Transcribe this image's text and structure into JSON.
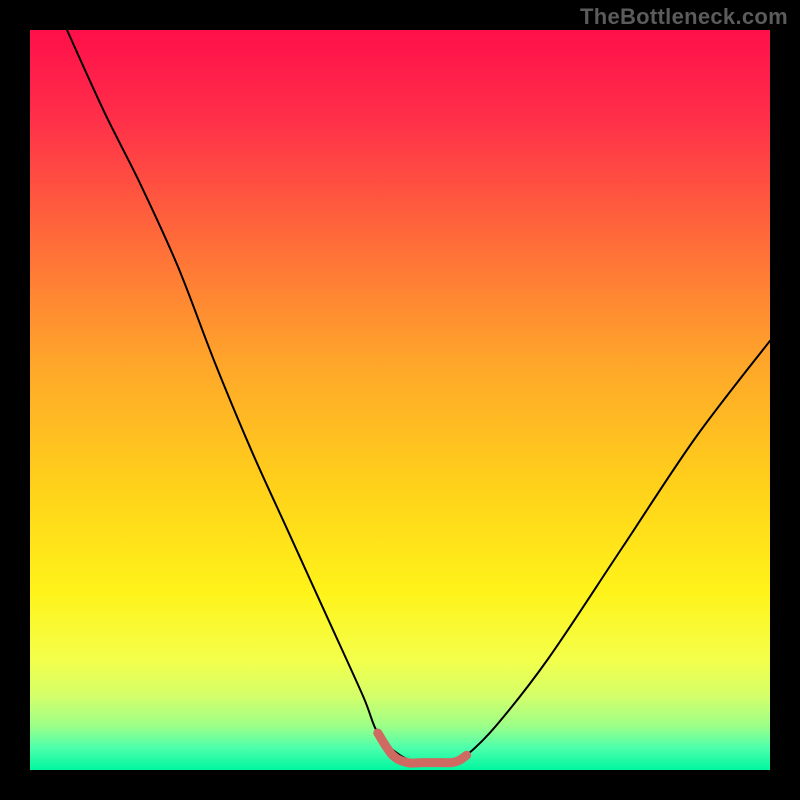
{
  "watermark": "TheBottleneck.com",
  "chart_data": {
    "type": "line",
    "title": "",
    "xlabel": "",
    "ylabel": "",
    "xlim": [
      0,
      100
    ],
    "ylim": [
      0,
      100
    ],
    "grid": false,
    "legend": false,
    "series": [
      {
        "name": "bottleneck-curve",
        "color": "#000000",
        "width": 2,
        "x": [
          5,
          10,
          15,
          20,
          25,
          30,
          35,
          40,
          45,
          47,
          50,
          53,
          57,
          59,
          63,
          70,
          80,
          90,
          100
        ],
        "y": [
          100,
          89,
          79,
          68,
          55,
          43,
          32,
          21,
          10,
          5,
          2,
          1,
          1,
          2,
          6,
          15,
          30,
          45,
          58
        ]
      },
      {
        "name": "bottleneck-zone-band",
        "color": "#cf6a62",
        "width": 9,
        "x": [
          47,
          49,
          51,
          53,
          55,
          57,
          58,
          59
        ],
        "y": [
          5,
          2,
          1,
          1,
          1,
          1,
          1.3,
          2
        ]
      }
    ],
    "background_gradient_stops": [
      {
        "offset": 0.0,
        "color": "#ff0f4a"
      },
      {
        "offset": 0.12,
        "color": "#ff2f49"
      },
      {
        "offset": 0.28,
        "color": "#ff6a3a"
      },
      {
        "offset": 0.45,
        "color": "#ffa62a"
      },
      {
        "offset": 0.62,
        "color": "#ffd21a"
      },
      {
        "offset": 0.76,
        "color": "#fff31a"
      },
      {
        "offset": 0.85,
        "color": "#f4ff4a"
      },
      {
        "offset": 0.9,
        "color": "#d4ff6a"
      },
      {
        "offset": 0.94,
        "color": "#9dff88"
      },
      {
        "offset": 0.97,
        "color": "#4dffac"
      },
      {
        "offset": 1.0,
        "color": "#00f7a0"
      }
    ]
  }
}
